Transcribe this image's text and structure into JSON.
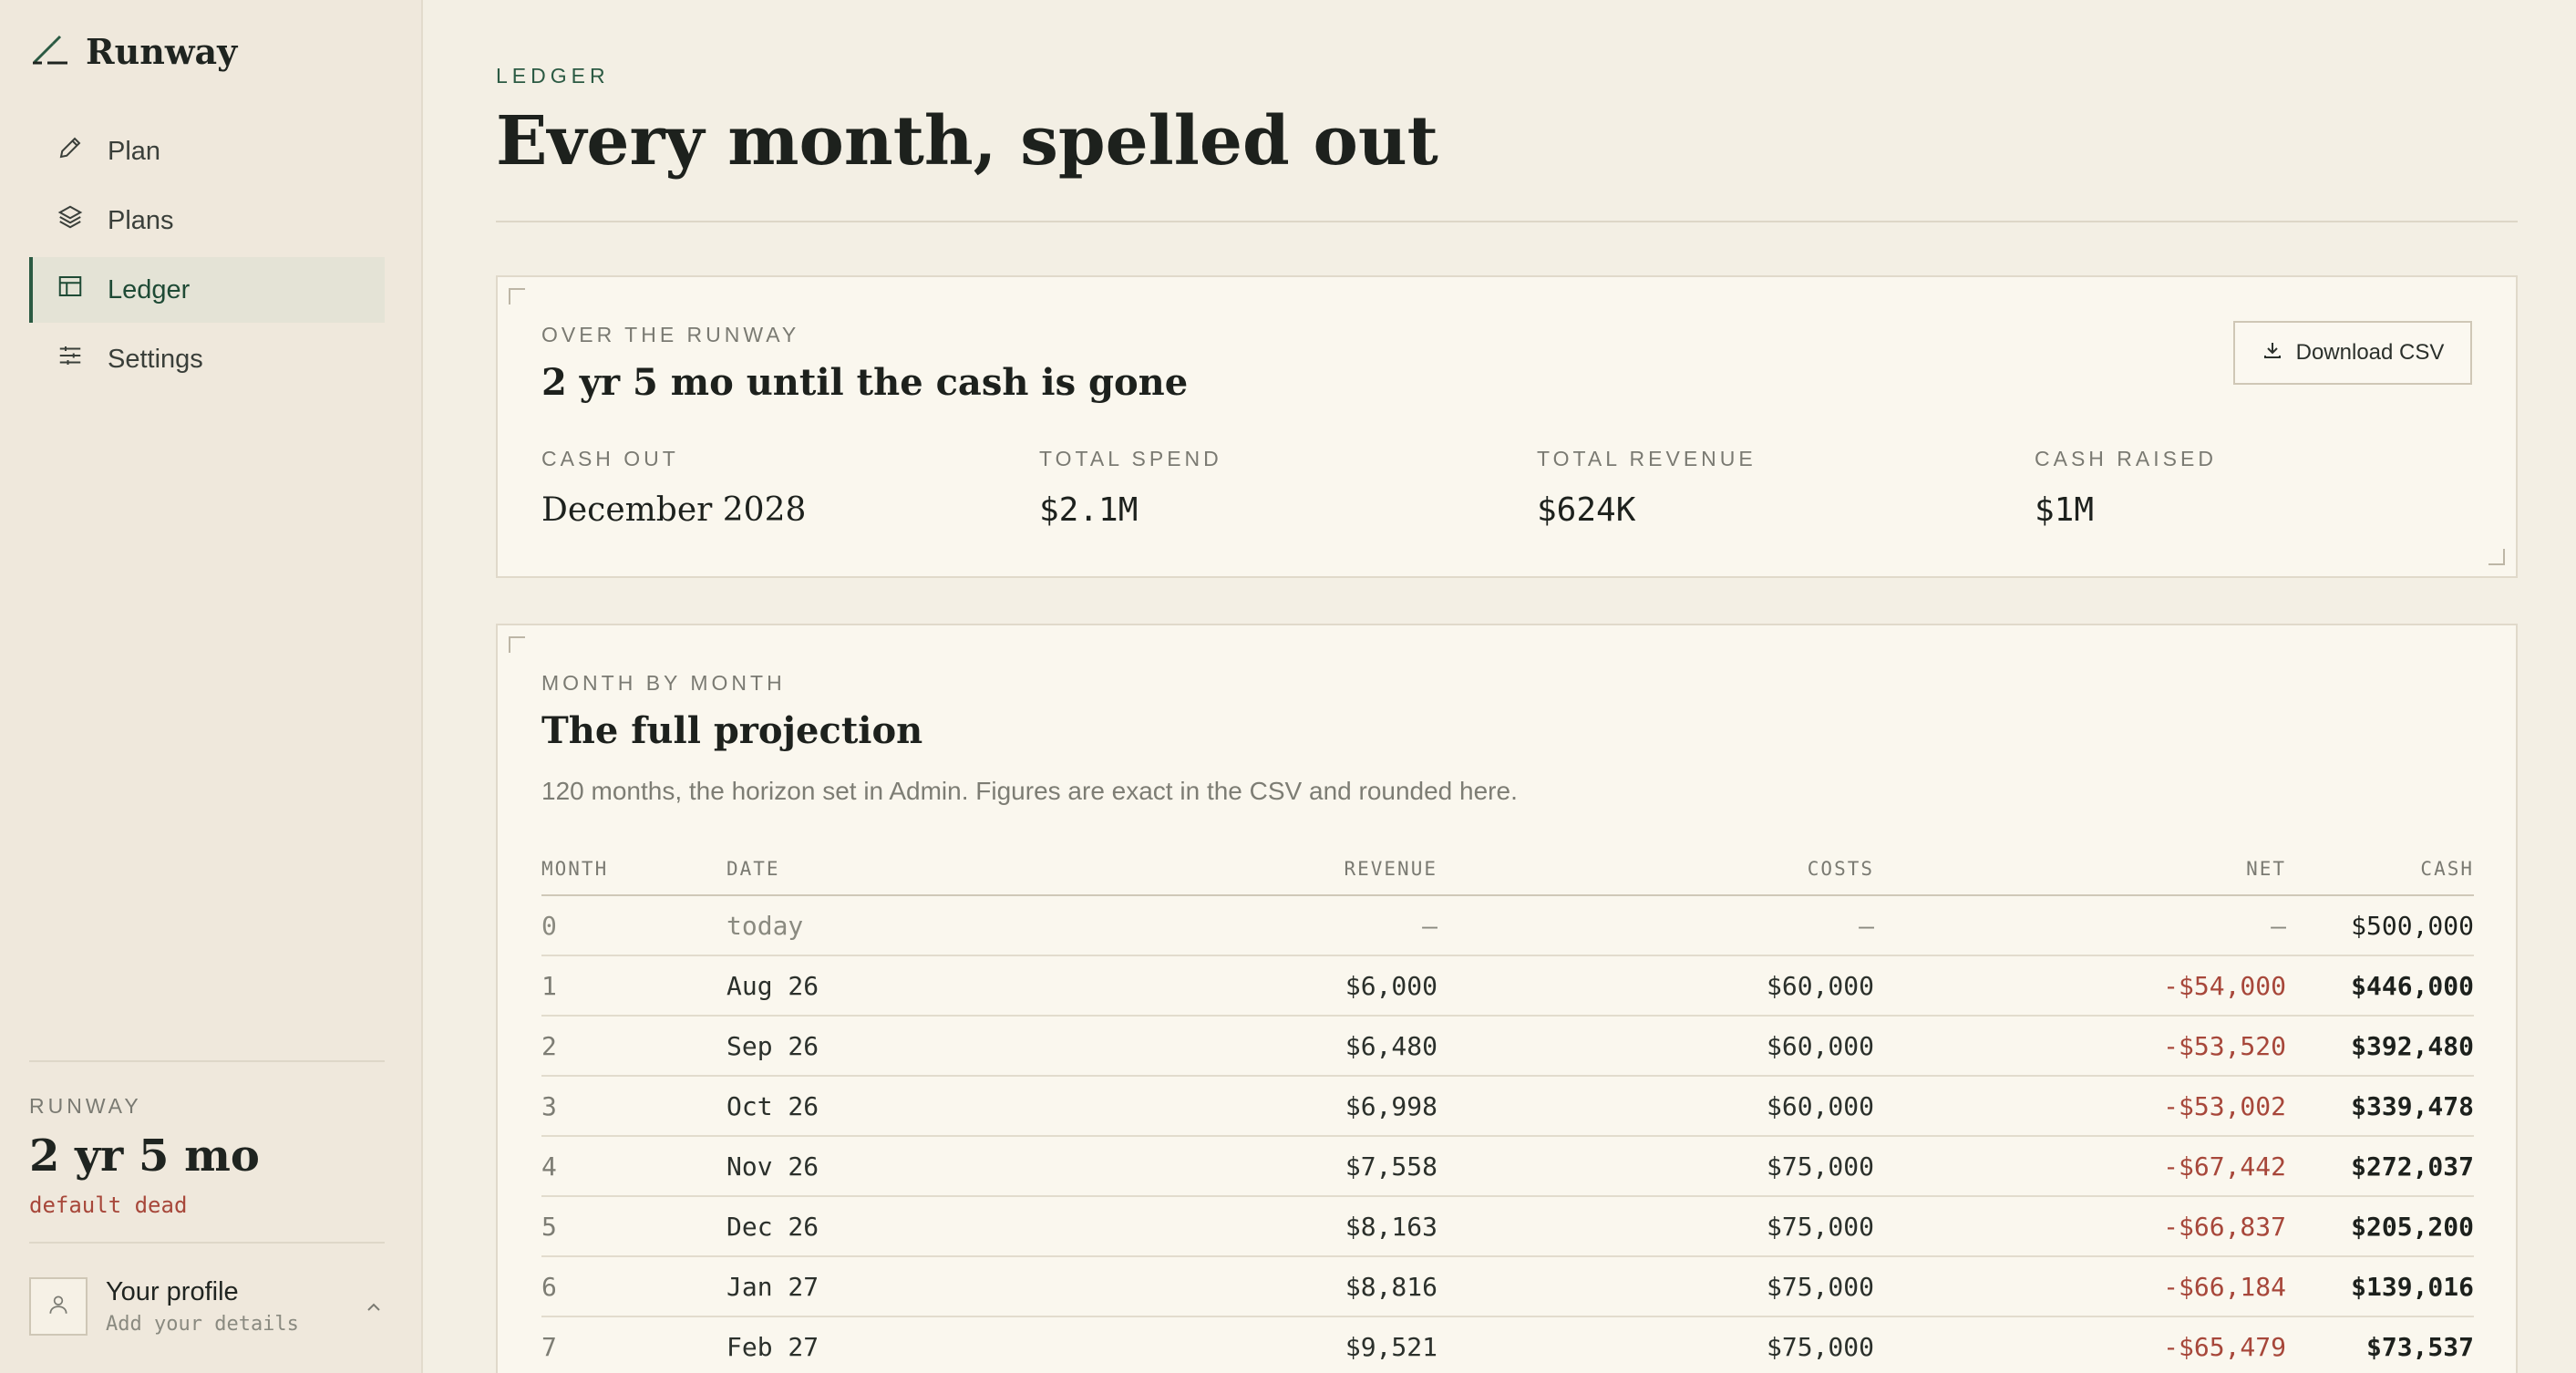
{
  "brand": {
    "name": "Runway"
  },
  "nav": [
    {
      "label": "Plan",
      "icon": "pencil-icon",
      "active": false
    },
    {
      "label": "Plans",
      "icon": "layers-icon",
      "active": false
    },
    {
      "label": "Ledger",
      "icon": "table-icon",
      "active": true
    },
    {
      "label": "Settings",
      "icon": "sliders-icon",
      "active": false
    }
  ],
  "sidebar_runway": {
    "label": "RUNWAY",
    "value": "2 yr 5 mo",
    "status": "default dead"
  },
  "profile": {
    "name": "Your profile",
    "subtitle": "Add your details"
  },
  "header": {
    "eyebrow": "LEDGER",
    "title": "Every month, spelled out"
  },
  "summary": {
    "eyebrow": "OVER THE RUNWAY",
    "title": "2 yr 5 mo until the cash is gone",
    "download_label": "Download CSV",
    "stats": [
      {
        "label": "CASH OUT",
        "value": "December 2028"
      },
      {
        "label": "TOTAL SPEND",
        "value": "$2.1M"
      },
      {
        "label": "TOTAL REVENUE",
        "value": "$624K"
      },
      {
        "label": "CASH RAISED",
        "value": "$1M"
      }
    ]
  },
  "projection": {
    "eyebrow": "MONTH BY MONTH",
    "title": "The full projection",
    "subtitle": "120 months, the horizon set in Admin. Figures are exact in the CSV and rounded here.",
    "columns": [
      "MONTH",
      "DATE",
      "REVENUE",
      "COSTS",
      "NET",
      "CASH"
    ],
    "rows": [
      {
        "month": "0",
        "date": "today",
        "revenue": "—",
        "costs": "—",
        "net": "—",
        "cash": "$500,000"
      },
      {
        "month": "1",
        "date": "Aug 26",
        "revenue": "$6,000",
        "costs": "$60,000",
        "net": "-$54,000",
        "cash": "$446,000"
      },
      {
        "month": "2",
        "date": "Sep 26",
        "revenue": "$6,480",
        "costs": "$60,000",
        "net": "-$53,520",
        "cash": "$392,480"
      },
      {
        "month": "3",
        "date": "Oct 26",
        "revenue": "$6,998",
        "costs": "$60,000",
        "net": "-$53,002",
        "cash": "$339,478"
      },
      {
        "month": "4",
        "date": "Nov 26",
        "revenue": "$7,558",
        "costs": "$75,000",
        "net": "-$67,442",
        "cash": "$272,037"
      },
      {
        "month": "5",
        "date": "Dec 26",
        "revenue": "$8,163",
        "costs": "$75,000",
        "net": "-$66,837",
        "cash": "$205,200"
      },
      {
        "month": "6",
        "date": "Jan 27",
        "revenue": "$8,816",
        "costs": "$75,000",
        "net": "-$66,184",
        "cash": "$139,016"
      },
      {
        "month": "7",
        "date": "Feb 27",
        "revenue": "$9,521",
        "costs": "$75,000",
        "net": "-$65,479",
        "cash": "$73,537"
      }
    ]
  },
  "colors": {
    "accent": "#2b5a43",
    "negative": "#a7473a",
    "background": "#f3efe4",
    "card": "#faf7ee"
  }
}
